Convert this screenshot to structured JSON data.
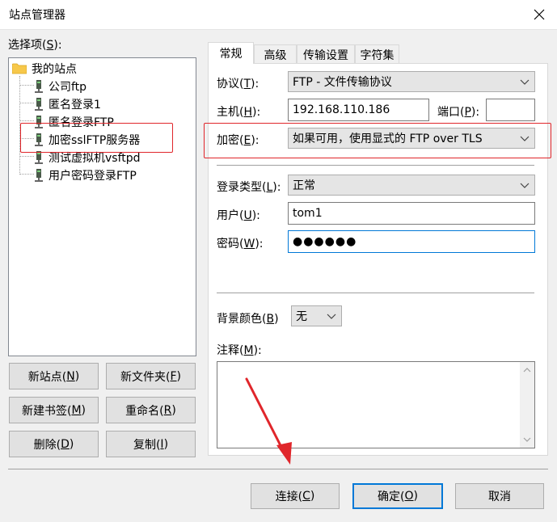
{
  "window": {
    "title": "站点管理器"
  },
  "left": {
    "select_label": "选择项(",
    "select_key": "S",
    "select_suffix": "):",
    "root": "我的站点",
    "sites": [
      "公司ftp",
      "匿名登录1",
      "匿名登录FTP",
      "加密sslFTP服务器",
      "测试虚拟机vsftpd",
      "用户密码登录FTP"
    ],
    "buttons": {
      "new_site": {
        "text": "新站点(",
        "key": "N",
        "suffix": ")"
      },
      "new_folder": {
        "text": "新文件夹(",
        "key": "F",
        "suffix": ")"
      },
      "new_bookmark": {
        "text": "新建书签(",
        "key": "M",
        "suffix": ")"
      },
      "rename": {
        "text": "重命名(",
        "key": "R",
        "suffix": ")"
      },
      "delete": {
        "text": "删除(",
        "key": "D",
        "suffix": ")"
      },
      "copy": {
        "text": "复制(",
        "key": "I",
        "suffix": ")"
      }
    }
  },
  "tabs": [
    "常规",
    "高级",
    "传输设置",
    "字符集"
  ],
  "general": {
    "protocol": {
      "label": "协议(",
      "key": "T",
      "suffix": "):",
      "value": "FTP - 文件传输协议"
    },
    "host": {
      "label": "主机(",
      "key": "H",
      "suffix": "):",
      "value": "192.168.110.186"
    },
    "port": {
      "label": "端口(",
      "key": "P",
      "suffix": "):",
      "value": ""
    },
    "encryption": {
      "label": "加密(",
      "key": "E",
      "suffix": "):",
      "value": "如果可用，使用显式的 FTP over TLS"
    },
    "logon_type": {
      "label": "登录类型(",
      "key": "L",
      "suffix": "):",
      "value": "正常"
    },
    "user": {
      "label": "用户(",
      "key": "U",
      "suffix": "):",
      "value": "tom1"
    },
    "password": {
      "label": "密码(",
      "key": "W",
      "suffix": "):",
      "value": "●●●●●●"
    },
    "bg_color": {
      "label": "背景颜色(",
      "key": "B",
      "suffix": ")",
      "value": "无"
    },
    "comments": {
      "label": "注释(",
      "key": "M",
      "suffix": "):",
      "value": ""
    }
  },
  "footer": {
    "connect": {
      "text": "连接(",
      "key": "C",
      "suffix": ")"
    },
    "ok": {
      "text": "确定(",
      "key": "O",
      "suffix": ")"
    },
    "cancel": {
      "text": "取消"
    }
  },
  "colors": {
    "highlight_box": "#e0262b",
    "arrow": "#e0262b",
    "focus": "#0078d7"
  }
}
